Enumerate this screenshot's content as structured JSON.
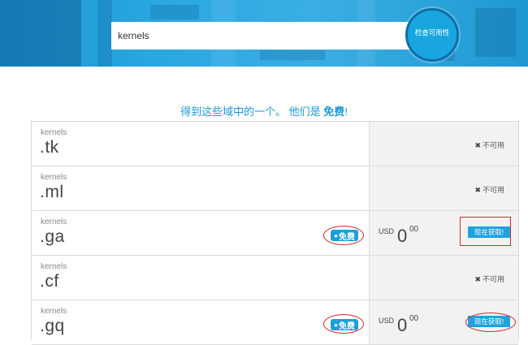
{
  "search": {
    "value": "kernels",
    "button_label": "检查可用性"
  },
  "headline": {
    "prefix": "得到这些域中的一个。 他们是 ",
    "free": "免费",
    "suffix": "!"
  },
  "rows": [
    {
      "name": "kernels",
      "tld": ".tk",
      "available": false,
      "status": "不可用"
    },
    {
      "name": "kernels",
      "tld": ".ml",
      "available": false,
      "status": "不可用"
    },
    {
      "name": "kernels",
      "tld": ".ga",
      "available": true,
      "badge": "免费",
      "currency": "USD",
      "price_whole": "0",
      "price_cents": "00",
      "button": "现在获取!"
    },
    {
      "name": "kernels",
      "tld": ".cf",
      "available": false,
      "status": "不可用"
    },
    {
      "name": "kernels",
      "tld": ".gq",
      "available": true,
      "badge": "免费",
      "currency": "USD",
      "price_whole": "0",
      "price_cents": "00",
      "button": "现在获取!"
    }
  ],
  "colors": {
    "accent": "#1d9fdc",
    "highlight": "#d6262e",
    "hero": "#2aa7e0"
  }
}
